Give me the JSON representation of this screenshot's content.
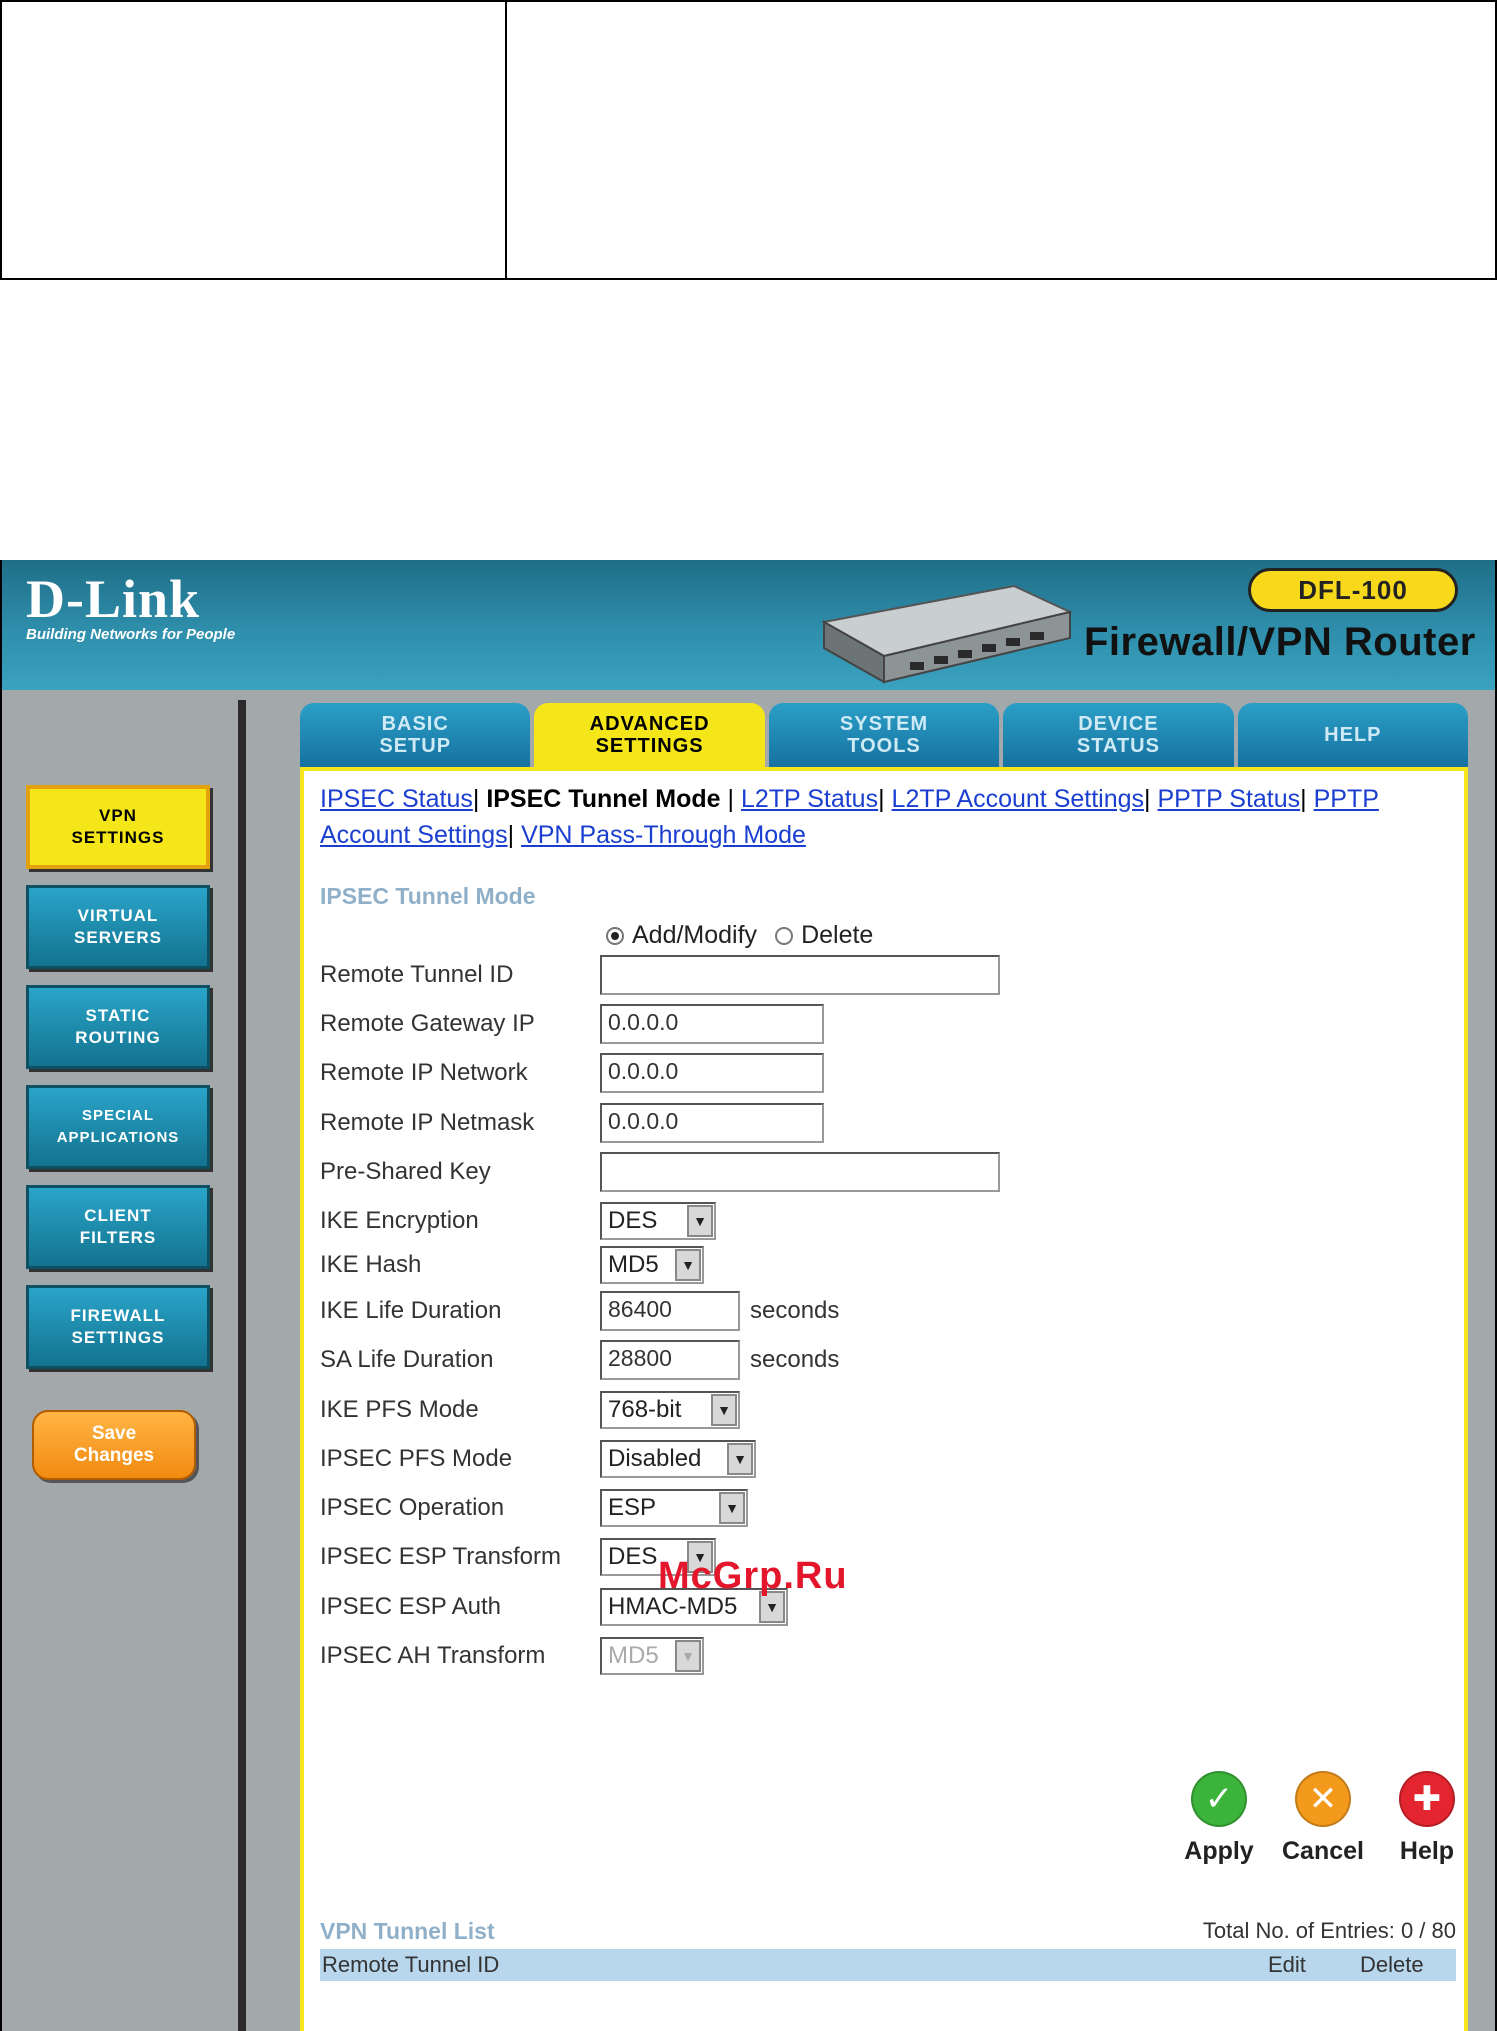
{
  "header": {
    "brand": "D-Link",
    "tagline": "Building Networks for People",
    "model": "DFL-100",
    "product": "Firewall/VPN Router"
  },
  "tabs": [
    {
      "label": "BASIC\nSETUP",
      "active": false
    },
    {
      "label": "ADVANCED\nSETTINGS",
      "active": true
    },
    {
      "label": "SYSTEM\nTOOLS",
      "active": false
    },
    {
      "label": "DEVICE\nSTATUS",
      "active": false
    },
    {
      "label": "HELP",
      "active": false
    }
  ],
  "sidebar": {
    "items": [
      {
        "label": "VPN\nSETTINGS",
        "active": true
      },
      {
        "label": "VIRTUAL\nSERVERS",
        "active": false
      },
      {
        "label": "STATIC\nROUTING",
        "active": false
      },
      {
        "label": "SPECIAL\nAPPLICATIONS",
        "active": false
      },
      {
        "label": "CLIENT\nFILTERS",
        "active": false
      },
      {
        "label": "FIREWALL\nSETTINGS",
        "active": false
      }
    ],
    "save_label": "Save\nChanges"
  },
  "subnav": {
    "l1": "IPSEC Status",
    "current": "IPSEC Tunnel Mode",
    "l3": "L2TP Status",
    "l4": "L2TP Account Settings",
    "l5": "PPTP Status",
    "l6": "PPTP Account Settings",
    "l7": "VPN Pass-Through Mode"
  },
  "section_title": "IPSEC Tunnel Mode",
  "form": {
    "mode_add": "Add/Modify",
    "mode_delete": "Delete",
    "remote_tunnel_id": {
      "label": "Remote Tunnel ID",
      "value": ""
    },
    "remote_gateway_ip": {
      "label": "Remote Gateway IP",
      "value": "0.0.0.0"
    },
    "remote_ip_network": {
      "label": "Remote IP Network",
      "value": "0.0.0.0"
    },
    "remote_ip_netmask": {
      "label": "Remote IP Netmask",
      "value": "0.0.0.0"
    },
    "pre_shared_key": {
      "label": "Pre-Shared Key",
      "value": ""
    },
    "ike_encryption": {
      "label": "IKE Encryption",
      "value": "DES"
    },
    "ike_hash": {
      "label": "IKE Hash",
      "value": "MD5"
    },
    "ike_life": {
      "label": "IKE Life Duration",
      "value": "86400",
      "unit": "seconds"
    },
    "sa_life": {
      "label": "SA Life Duration",
      "value": "28800",
      "unit": "seconds"
    },
    "ike_pfs": {
      "label": "IKE PFS Mode",
      "value": "768-bit"
    },
    "ipsec_pfs": {
      "label": "IPSEC PFS Mode",
      "value": "Disabled"
    },
    "ipsec_op": {
      "label": "IPSEC Operation",
      "value": "ESP"
    },
    "esp_transform": {
      "label": "IPSEC ESP Transform",
      "value": "DES"
    },
    "esp_auth": {
      "label": "IPSEC ESP Auth",
      "value": "HMAC-MD5"
    },
    "ah_transform": {
      "label": "IPSEC AH Transform",
      "value": "MD5"
    }
  },
  "actions": {
    "apply": "Apply",
    "cancel": "Cancel",
    "help": "Help"
  },
  "tunnel_list": {
    "title": "VPN Tunnel List",
    "total": "Total No. of Entries: 0 / 80",
    "col_id": "Remote Tunnel ID",
    "col_edit": "Edit",
    "col_delete": "Delete"
  },
  "watermark": "McGrp.Ru"
}
